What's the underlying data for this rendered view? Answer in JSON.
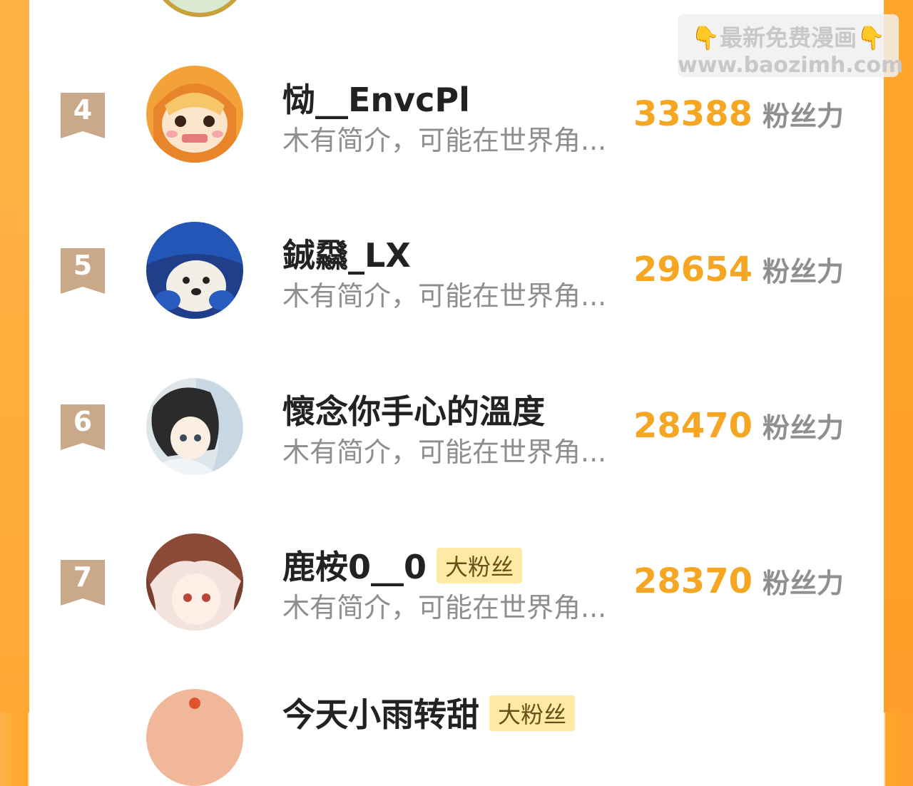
{
  "watermark": {
    "line1": "👇最新免费漫画👇",
    "line2": "www.baozimh.com"
  },
  "rankings": [
    {
      "rank": "4",
      "name": "恸__EnvcPl",
      "badge": "",
      "intro": "木有简介，可能在世界角...",
      "fans": "33388",
      "fans_unit": "粉丝力"
    },
    {
      "rank": "5",
      "name": "鋮飝_LX",
      "badge": "",
      "intro": "木有简介，可能在世界角...",
      "fans": "29654",
      "fans_unit": "粉丝力"
    },
    {
      "rank": "6",
      "name": "懷念你手心的溫度",
      "badge": "",
      "intro": "木有简介，可能在世界角...",
      "fans": "28470",
      "fans_unit": "粉丝力"
    },
    {
      "rank": "7",
      "name": "鹿桉0__0",
      "badge": "大粉丝",
      "intro": "木有简介，可能在世界角...",
      "fans": "28370",
      "fans_unit": "粉丝力"
    }
  ],
  "partial_next": {
    "name": "今天小雨转甜",
    "badge": "大粉丝"
  },
  "colors": {
    "accent": "#f5a623",
    "badge_bg": "#fdeba5",
    "rank_badge": "#c9a98a"
  }
}
